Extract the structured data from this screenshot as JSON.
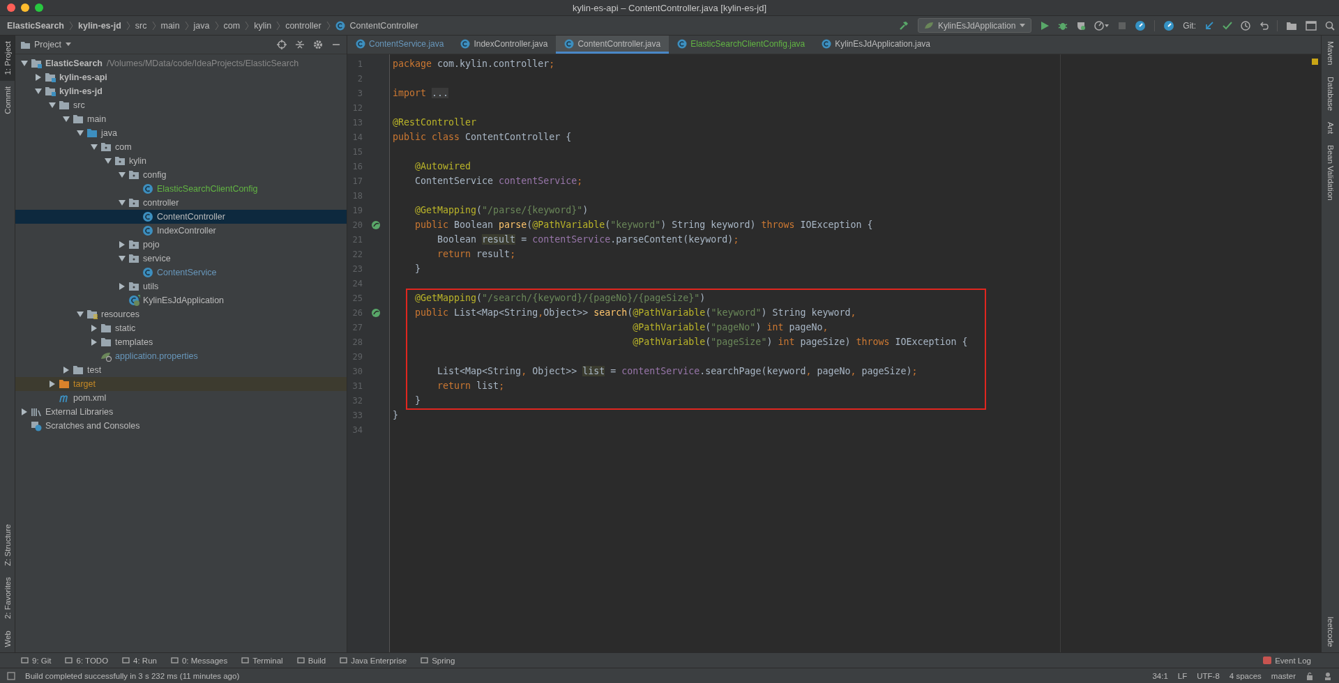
{
  "window": {
    "title": "kylin-es-api – ContentController.java [kylin-es-jd]"
  },
  "breadcrumbs": [
    {
      "label": "ElasticSearch",
      "kind": "module"
    },
    {
      "label": "kylin-es-jd",
      "kind": "module"
    },
    {
      "label": "src",
      "kind": "folder"
    },
    {
      "label": "main",
      "kind": "folder"
    },
    {
      "label": "java",
      "kind": "folder"
    },
    {
      "label": "com",
      "kind": "folder"
    },
    {
      "label": "kylin",
      "kind": "folder"
    },
    {
      "label": "controller",
      "kind": "folder"
    },
    {
      "label": "ContentController",
      "kind": "class"
    }
  ],
  "toolbar": {
    "run_config": "KylinEsJdApplication",
    "git_label": "Git:"
  },
  "left_strip": [
    {
      "label": "1: Project",
      "selected": true
    },
    {
      "label": "Commit",
      "selected": false
    },
    {
      "label": "Z: Structure",
      "selected": false
    },
    {
      "label": "2: Favorites",
      "selected": false
    },
    {
      "label": "Web",
      "selected": false
    }
  ],
  "right_strip": [
    {
      "label": "Maven"
    },
    {
      "label": "Database"
    },
    {
      "label": "Ant"
    },
    {
      "label": "Bean Validation"
    },
    {
      "label": "leetcode"
    }
  ],
  "project_panel": {
    "title": "Project",
    "tree": [
      {
        "label": "ElasticSearch",
        "path": "/Volumes/MData/code/IdeaProjects/ElasticSearch",
        "kind": "module",
        "expanded": true,
        "selected": false,
        "color": "#bbbbbb",
        "children": [
          {
            "label": "kylin-es-api",
            "kind": "module",
            "expanded": false,
            "selected": false,
            "color": "#bbbbbb"
          },
          {
            "label": "kylin-es-jd",
            "kind": "module",
            "expanded": true,
            "selected": false,
            "color": "#bbbbbb",
            "children": [
              {
                "label": "src",
                "kind": "folder",
                "expanded": true,
                "selected": false,
                "color": "#bbbbbb",
                "children": [
                  {
                    "label": "main",
                    "kind": "folder",
                    "expanded": true,
                    "selected": false,
                    "color": "#bbbbbb",
                    "children": [
                      {
                        "label": "java",
                        "kind": "source",
                        "expanded": true,
                        "selected": false,
                        "color": "#bbbbbb",
                        "children": [
                          {
                            "label": "com",
                            "kind": "package",
                            "expanded": true,
                            "selected": false,
                            "color": "#bbbbbb",
                            "children": [
                              {
                                "label": "kylin",
                                "kind": "package",
                                "expanded": true,
                                "selected": false,
                                "color": "#bbbbbb",
                                "children": [
                                  {
                                    "label": "config",
                                    "kind": "package",
                                    "expanded": true,
                                    "selected": false,
                                    "color": "#bbbbbb",
                                    "children": [
                                      {
                                        "label": "ElasticSearchClientConfig",
                                        "kind": "class",
                                        "selected": false,
                                        "color": "#62b543"
                                      }
                                    ]
                                  },
                                  {
                                    "label": "controller",
                                    "kind": "package",
                                    "expanded": true,
                                    "selected": false,
                                    "color": "#bbbbbb",
                                    "children": [
                                      {
                                        "label": "ContentController",
                                        "kind": "class",
                                        "selected": true,
                                        "color": "#bbbbbb"
                                      },
                                      {
                                        "label": "IndexController",
                                        "kind": "class",
                                        "selected": false,
                                        "color": "#bbbbbb"
                                      }
                                    ]
                                  },
                                  {
                                    "label": "pojo",
                                    "kind": "package",
                                    "expanded": false,
                                    "selected": false,
                                    "color": "#bbbbbb"
                                  },
                                  {
                                    "label": "service",
                                    "kind": "package",
                                    "expanded": true,
                                    "selected": false,
                                    "color": "#bbbbbb",
                                    "children": [
                                      {
                                        "label": "ContentService",
                                        "kind": "class",
                                        "selected": false,
                                        "color": "#6897bb"
                                      }
                                    ]
                                  },
                                  {
                                    "label": "utils",
                                    "kind": "package",
                                    "expanded": false,
                                    "selected": false,
                                    "color": "#bbbbbb"
                                  },
                                  {
                                    "label": "KylinEsJdApplication",
                                    "kind": "boot",
                                    "selected": false,
                                    "color": "#bbbbbb"
                                  }
                                ]
                              }
                            ]
                          }
                        ]
                      },
                      {
                        "label": "resources",
                        "kind": "resources",
                        "expanded": true,
                        "selected": false,
                        "color": "#bbbbbb",
                        "children": [
                          {
                            "label": "static",
                            "kind": "folder",
                            "expanded": false,
                            "selected": false,
                            "color": "#bbbbbb"
                          },
                          {
                            "label": "templates",
                            "kind": "folder",
                            "expanded": false,
                            "selected": false,
                            "color": "#bbbbbb"
                          },
                          {
                            "label": "application.properties",
                            "kind": "properties",
                            "selected": false,
                            "color": "#6897bb"
                          }
                        ]
                      }
                    ]
                  },
                  {
                    "label": "test",
                    "kind": "folder",
                    "expanded": false,
                    "selected": false,
                    "color": "#bbbbbb"
                  }
                ]
              },
              {
                "label": "target",
                "kind": "excluded",
                "expanded": false,
                "selected": false,
                "color": "#c78a26"
              },
              {
                "label": "pom.xml",
                "kind": "maven",
                "selected": false,
                "color": "#bbbbbb"
              }
            ]
          }
        ]
      },
      {
        "label": "External Libraries",
        "kind": "libraries",
        "expanded": false,
        "selected": false,
        "color": "#bbbbbb"
      },
      {
        "label": "Scratches and Consoles",
        "kind": "scratches",
        "selected": false,
        "color": "#bbbbbb"
      }
    ]
  },
  "editor_tabs": [
    {
      "label": "ContentService.java",
      "selected": false,
      "color": "#6897bb"
    },
    {
      "label": "IndexController.java",
      "selected": false,
      "color": "#bbbbbb"
    },
    {
      "label": "ContentController.java",
      "selected": true,
      "color": "#bbbbbb"
    },
    {
      "label": "ElasticSearchClientConfig.java",
      "selected": false,
      "color": "#62b543"
    },
    {
      "label": "KylinEsJdApplication.java",
      "selected": false,
      "color": "#bbbbbb"
    }
  ],
  "code": {
    "blocks": [
      {
        "boxed": false,
        "lines": [
          {
            "number": "1",
            "run_marker": false,
            "segments": [
              {
                "t": "package ",
                "kind": "kw"
              },
              {
                "t": "com.kylin.controller",
                "kind": "plain"
              },
              {
                "t": ";",
                "kind": "kw"
              }
            ]
          },
          {
            "number": "2",
            "run_marker": false
          },
          {
            "number": "3",
            "run_marker": false,
            "segments": [
              {
                "t": "import ",
                "kind": "kw"
              },
              {
                "t": "...",
                "kind": "folded"
              }
            ]
          },
          {
            "number": "12",
            "run_marker": false
          },
          {
            "number": "13",
            "run_marker": false,
            "segments": [
              {
                "t": "@RestController",
                "kind": "ann"
              }
            ]
          },
          {
            "number": "14",
            "run_marker": false,
            "segments": [
              {
                "t": "public class ",
                "kind": "kw"
              },
              {
                "t": "ContentController {",
                "kind": "plain"
              }
            ]
          },
          {
            "number": "15",
            "run_marker": false
          },
          {
            "number": "16",
            "run_marker": false,
            "segments": [
              {
                "t": "    @Autowired",
                "kind": "ann"
              }
            ]
          },
          {
            "number": "17",
            "run_marker": false,
            "segments": [
              {
                "t": "    ContentService ",
                "kind": "plain"
              },
              {
                "t": "contentService",
                "kind": "field"
              },
              {
                "t": ";",
                "kind": "kw"
              }
            ]
          },
          {
            "number": "18",
            "run_marker": false
          },
          {
            "number": "19",
            "run_marker": false,
            "segments": [
              {
                "t": "    @GetMapping",
                "kind": "ann"
              },
              {
                "t": "(",
                "kind": "plain"
              },
              {
                "t": "\"/parse/{keyword}\"",
                "kind": "str"
              },
              {
                "t": ")",
                "kind": "plain"
              }
            ]
          },
          {
            "number": "20",
            "run_marker": true,
            "segments": [
              {
                "t": "    public ",
                "kind": "kw"
              },
              {
                "t": "Boolean ",
                "kind": "plain"
              },
              {
                "t": "parse",
                "kind": "fn"
              },
              {
                "t": "(",
                "kind": "plain"
              },
              {
                "t": "@PathVariable",
                "kind": "ann"
              },
              {
                "t": "(",
                "kind": "plain"
              },
              {
                "t": "\"keyword\"",
                "kind": "str"
              },
              {
                "t": ") String keyword) ",
                "kind": "plain"
              },
              {
                "t": "throws ",
                "kind": "kw"
              },
              {
                "t": "IOException {",
                "kind": "plain"
              }
            ]
          },
          {
            "number": "21",
            "run_marker": false,
            "segments": [
              {
                "t": "        Boolean ",
                "kind": "plain"
              },
              {
                "t": "result",
                "kind": "usage"
              },
              {
                "t": " = ",
                "kind": "plain"
              },
              {
                "t": "contentService",
                "kind": "field"
              },
              {
                "t": ".parseContent(keyword)",
                "kind": "plain"
              },
              {
                "t": ";",
                "kind": "kw"
              }
            ]
          },
          {
            "number": "22",
            "run_marker": false,
            "segments": [
              {
                "t": "        return ",
                "kind": "kw"
              },
              {
                "t": "result",
                "kind": "plain"
              },
              {
                "t": ";",
                "kind": "kw"
              }
            ]
          },
          {
            "number": "23",
            "run_marker": false,
            "segments": [
              {
                "t": "    }",
                "kind": "plain"
              }
            ]
          },
          {
            "number": "24",
            "run_marker": false
          }
        ]
      },
      {
        "boxed": true,
        "lines": [
          {
            "number": "25",
            "run_marker": false,
            "segments": [
              {
                "t": "    @GetMapping",
                "kind": "ann"
              },
              {
                "t": "(",
                "kind": "plain"
              },
              {
                "t": "\"/search/{keyword}/{pageNo}/{pageSize}\"",
                "kind": "str"
              },
              {
                "t": ")",
                "kind": "plain"
              }
            ]
          },
          {
            "number": "26",
            "run_marker": true,
            "segments": [
              {
                "t": "    public ",
                "kind": "kw"
              },
              {
                "t": "List<Map<String",
                "kind": "plain"
              },
              {
                "t": ",",
                "kind": "kw"
              },
              {
                "t": "Object>> ",
                "kind": "plain"
              },
              {
                "t": "search",
                "kind": "fn"
              },
              {
                "t": "(",
                "kind": "plain"
              },
              {
                "t": "@PathVariable",
                "kind": "ann"
              },
              {
                "t": "(",
                "kind": "plain"
              },
              {
                "t": "\"keyword\"",
                "kind": "str"
              },
              {
                "t": ") String keyword",
                "kind": "plain"
              },
              {
                "t": ",",
                "kind": "kw"
              }
            ]
          },
          {
            "number": "27",
            "run_marker": false,
            "segments": [
              {
                "t": "                                           @PathVariable",
                "kind": "ann"
              },
              {
                "t": "(",
                "kind": "plain"
              },
              {
                "t": "\"pageNo\"",
                "kind": "str"
              },
              {
                "t": ") ",
                "kind": "plain"
              },
              {
                "t": "int ",
                "kind": "kw"
              },
              {
                "t": "pageNo",
                "kind": "plain"
              },
              {
                "t": ",",
                "kind": "kw"
              }
            ]
          },
          {
            "number": "28",
            "run_marker": false,
            "segments": [
              {
                "t": "                                           @PathVariable",
                "kind": "ann"
              },
              {
                "t": "(",
                "kind": "plain"
              },
              {
                "t": "\"pageSize\"",
                "kind": "str"
              },
              {
                "t": ") ",
                "kind": "plain"
              },
              {
                "t": "int ",
                "kind": "kw"
              },
              {
                "t": "pageSize) ",
                "kind": "plain"
              },
              {
                "t": "throws ",
                "kind": "kw"
              },
              {
                "t": "IOException {",
                "kind": "plain"
              }
            ]
          },
          {
            "number": "29",
            "run_marker": false
          },
          {
            "number": "30",
            "run_marker": false,
            "segments": [
              {
                "t": "        List<Map<String",
                "kind": "plain"
              },
              {
                "t": ", ",
                "kind": "kw"
              },
              {
                "t": "Object>> ",
                "kind": "plain"
              },
              {
                "t": "list",
                "kind": "usage"
              },
              {
                "t": " = ",
                "kind": "plain"
              },
              {
                "t": "contentService",
                "kind": "field"
              },
              {
                "t": ".searchPage(keyword",
                "kind": "plain"
              },
              {
                "t": ", ",
                "kind": "kw"
              },
              {
                "t": "pageNo",
                "kind": "plain"
              },
              {
                "t": ", ",
                "kind": "kw"
              },
              {
                "t": "pageSize)",
                "kind": "plain"
              },
              {
                "t": ";",
                "kind": "kw"
              }
            ]
          },
          {
            "number": "31",
            "run_marker": false,
            "segments": [
              {
                "t": "        return ",
                "kind": "kw"
              },
              {
                "t": "list",
                "kind": "plain"
              },
              {
                "t": ";",
                "kind": "kw"
              }
            ]
          },
          {
            "number": "32",
            "run_marker": false,
            "segments": [
              {
                "t": "    }",
                "kind": "plain"
              }
            ]
          }
        ]
      },
      {
        "boxed": false,
        "lines": [
          {
            "number": "33",
            "run_marker": false,
            "segments": [
              {
                "t": "}",
                "kind": "plain"
              }
            ]
          },
          {
            "number": "34",
            "run_marker": false
          }
        ]
      }
    ]
  },
  "bottom_tools": [
    {
      "label": "9: Git"
    },
    {
      "label": "6: TODO"
    },
    {
      "label": "4: Run"
    },
    {
      "label": "0: Messages"
    },
    {
      "label": "Terminal"
    },
    {
      "label": "Build"
    },
    {
      "label": "Java Enterprise"
    },
    {
      "label": "Spring"
    }
  ],
  "event_log": "Event Log",
  "status_bar": {
    "message": "Build completed successfully in 3 s 232 ms (11 minutes ago)",
    "items": [
      "34:1",
      "LF",
      "UTF-8",
      "4 spaces",
      "master"
    ]
  }
}
